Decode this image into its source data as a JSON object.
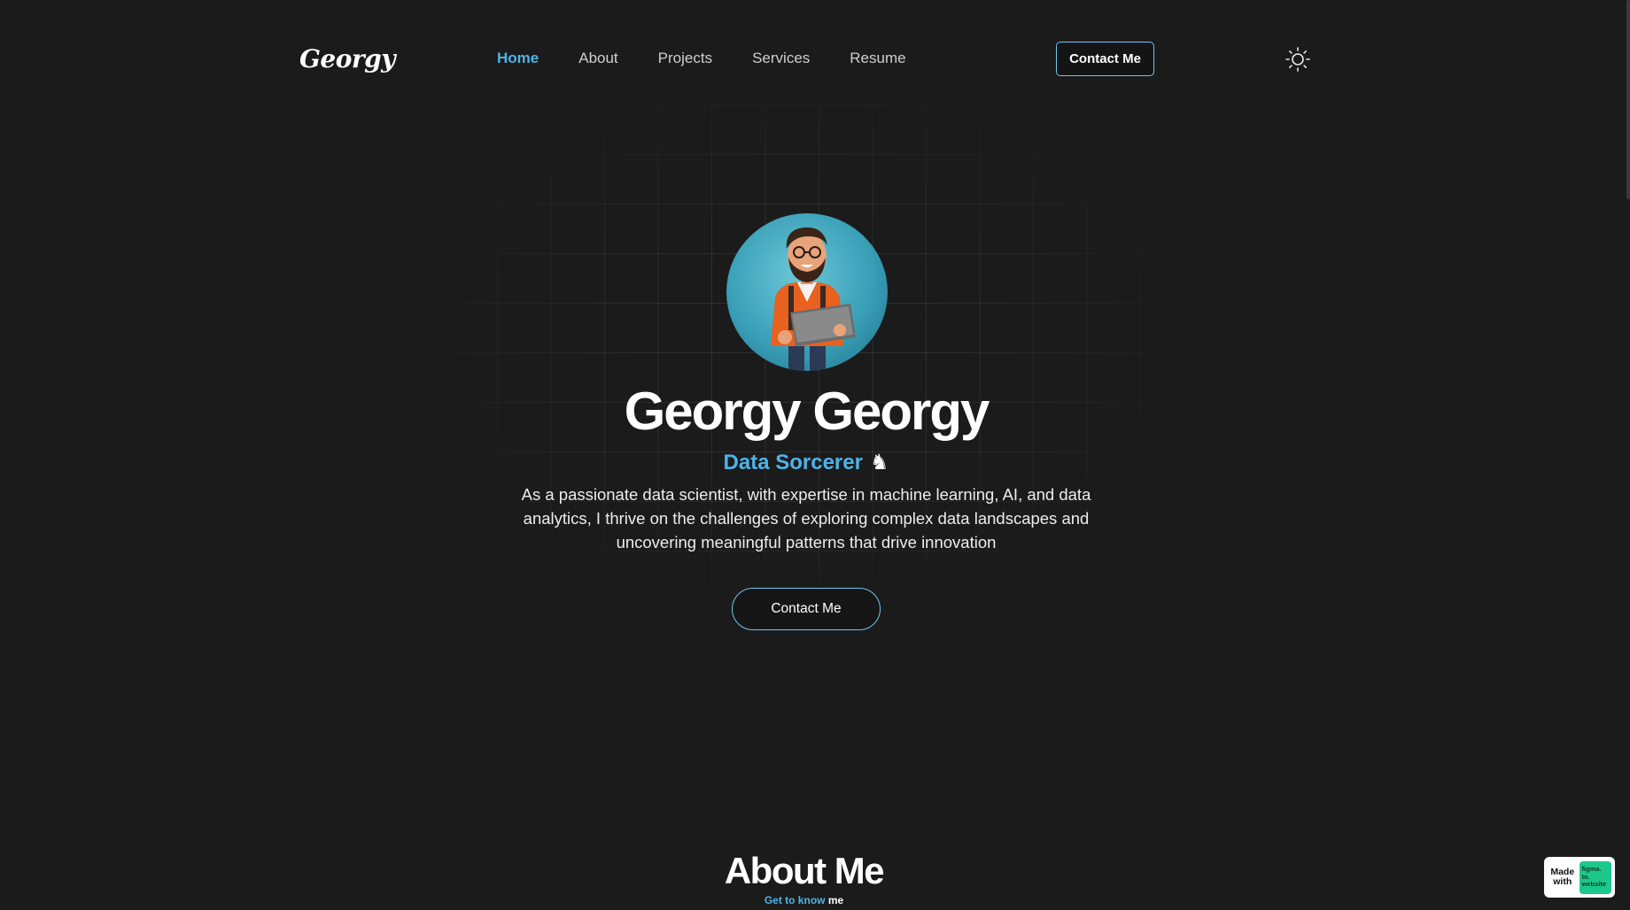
{
  "header": {
    "logo": "Georgy",
    "nav": [
      {
        "label": "Home",
        "active": true
      },
      {
        "label": "About",
        "active": false
      },
      {
        "label": "Projects",
        "active": false
      },
      {
        "label": "Services",
        "active": false
      },
      {
        "label": "Resume",
        "active": false
      }
    ],
    "contact_label": "Contact Me",
    "theme_icon": "sun-icon"
  },
  "hero": {
    "avatar_icon": "developer-avatar",
    "name": "Georgy Georgy",
    "role": "Data Sorcerer",
    "role_icon": "♞",
    "description": "As a passionate data scientist, with expertise in machine learning, AI, and data analytics, I thrive on the challenges of exploring complex data landscapes and uncovering meaningful patterns that drive innovation",
    "contact_label": "Contact Me"
  },
  "about": {
    "title": "About Me",
    "subtitle_prefix": "Get to know",
    "subtitle_suffix": "me"
  },
  "badge": {
    "made_with": "Made with",
    "figma_line1": "figma.",
    "figma_line2": "to.",
    "figma_line3": "website"
  },
  "colors": {
    "background": "#1b1b1b",
    "accent": "#4fb3e8",
    "border_accent": "#6fc6ef",
    "badge_green": "#1cc88a"
  }
}
